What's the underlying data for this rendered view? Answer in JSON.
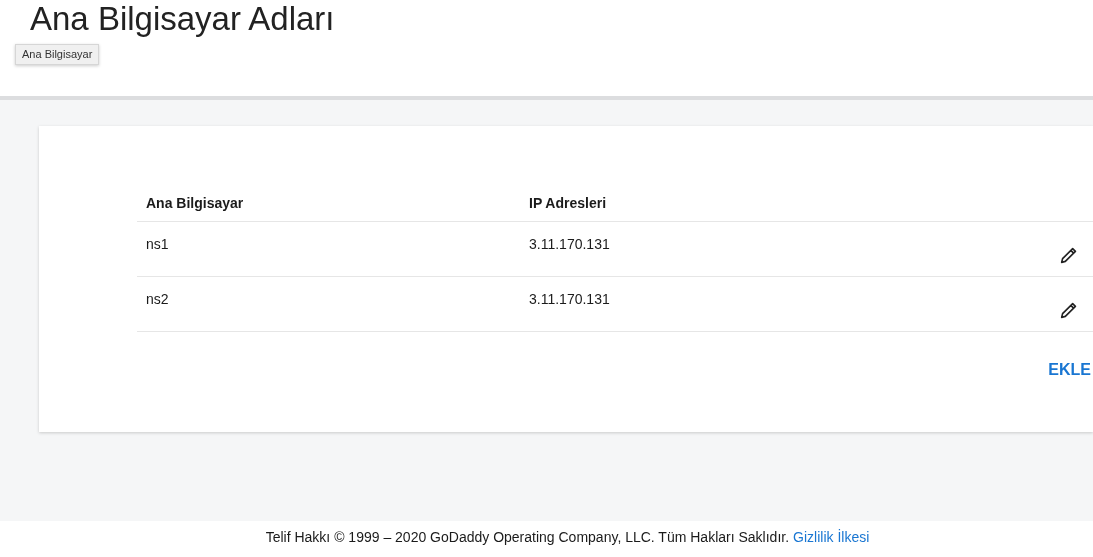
{
  "header": {
    "title": "Ana Bilgisayar Adları",
    "tooltip": "Ana Bilgisayar"
  },
  "table": {
    "columns": [
      "Ana Bilgisayar",
      "IP Adresleri"
    ],
    "rows": [
      {
        "host": "ns1",
        "ip": "3.11.170.131"
      },
      {
        "host": "ns2",
        "ip": "3.11.170.131"
      }
    ]
  },
  "add_button": "EKLE",
  "footer": {
    "copyright": "Telif Hakkı © 1999 – 2020 GoDaddy Operating Company, LLC. Tüm Hakları Saklıdır.",
    "link": "Gizlilik İlkesi"
  }
}
